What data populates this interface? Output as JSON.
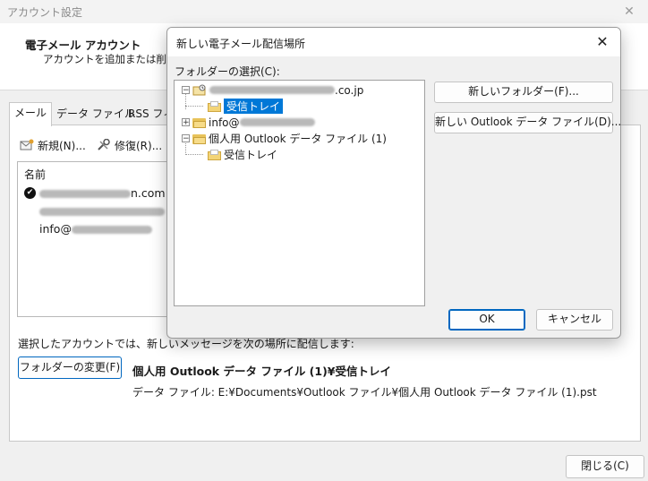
{
  "window": {
    "title": "アカウント設定",
    "close_glyph": "✕"
  },
  "header": {
    "title": "電子メール アカウント",
    "description": "アカウントを追加または削除で"
  },
  "tabs": [
    {
      "label": "メール"
    },
    {
      "label": "データ ファイル"
    },
    {
      "label": "RSS フィ"
    }
  ],
  "toolbar": {
    "new_label": "新規(N)...",
    "repair_label": "修復(R)..."
  },
  "account_list": {
    "header": "名前",
    "items": [
      {
        "visible_suffix": "n.com",
        "default": true
      },
      {
        "visible_prefix": "",
        "default": false
      },
      {
        "visible_prefix": "info@",
        "default": false
      }
    ]
  },
  "delivery": {
    "label": "選択したアカウントでは、新しいメッセージを次の場所に配信します:",
    "change_folder_label": "フォルダーの変更(F)",
    "path": "個人用 Outlook データ ファイル (1)¥受信トレイ",
    "data_file": "データ ファイル: E:¥Documents¥Outlook ファイル¥個人用 Outlook データ ファイル (1).pst"
  },
  "close_button_label": "閉じる(C)",
  "dialog": {
    "title": "新しい電子メール配信場所",
    "folder_select_label": "フォルダーの選択(C):",
    "tree": [
      {
        "label_suffix": ".co.jp",
        "level": 0,
        "expanded": true
      },
      {
        "label": "受信トレイ",
        "level": 1,
        "selected": true
      },
      {
        "label_prefix": "info@",
        "level": 0,
        "expanded": false
      },
      {
        "label": "個人用 Outlook データ ファイル (1)",
        "level": 0,
        "expanded": true
      },
      {
        "label": "受信トレイ",
        "level": 1,
        "selected": false
      }
    ],
    "new_folder_label": "新しいフォルダー(F)...",
    "new_datafile_label": "新しい Outlook データ ファイル(D)...",
    "ok_label": "OK",
    "cancel_label": "キャンセル"
  },
  "colors": {
    "accent": "#0078d7",
    "button_border_default": "#0067c0"
  }
}
